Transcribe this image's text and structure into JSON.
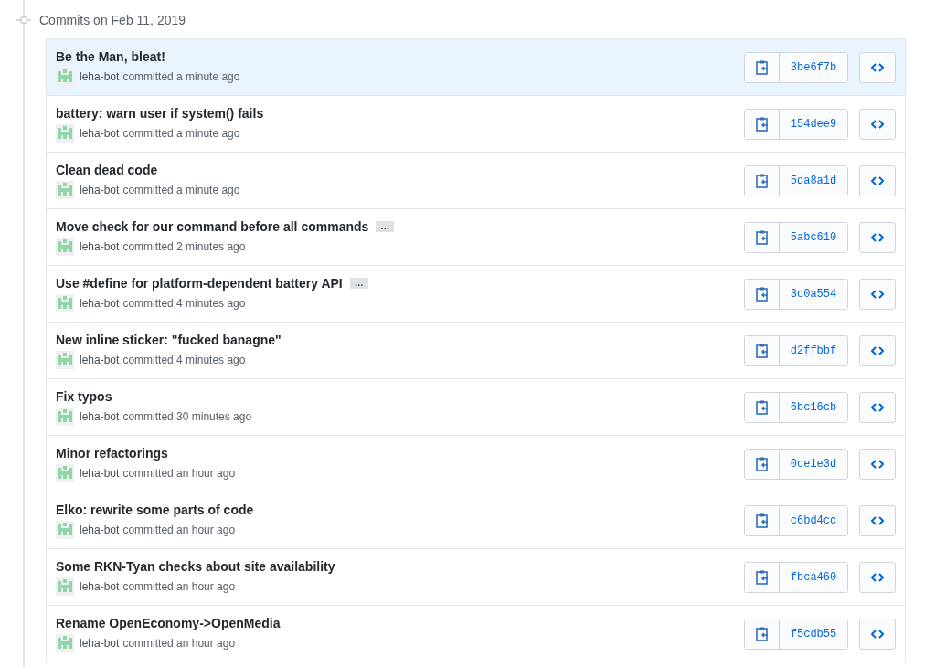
{
  "header": {
    "title": "Commits on Feb 11, 2019"
  },
  "commits": [
    {
      "message": "Be the Man, bleat!",
      "author": "leha-bot",
      "when": "committed a minute ago",
      "sha": "3be6f7b",
      "highlighted": true
    },
    {
      "message": "battery: warn user if system() fails",
      "author": "leha-bot",
      "when": "committed a minute ago",
      "sha": "154dee9",
      "highlighted": false
    },
    {
      "message": "Clean dead code",
      "author": "leha-bot",
      "when": "committed a minute ago",
      "sha": "5da8a1d",
      "highlighted": false
    },
    {
      "message": "Move check for our command before all commands",
      "expander": "…",
      "author": "leha-bot",
      "when": "committed 2 minutes ago",
      "sha": "5abc610",
      "highlighted": false
    },
    {
      "message": "Use #define for platform-dependent battery API",
      "expander": "…",
      "author": "leha-bot",
      "when": "committed 4 minutes ago",
      "sha": "3c0a554",
      "highlighted": false
    },
    {
      "message": "New inline sticker: \"fucked banagne\"",
      "author": "leha-bot",
      "when": "committed 4 minutes ago",
      "sha": "d2ffbbf",
      "highlighted": false
    },
    {
      "message": "Fix typos",
      "author": "leha-bot",
      "when": "committed 30 minutes ago",
      "sha": "6bc16cb",
      "highlighted": false
    },
    {
      "message": "Minor refactorings",
      "author": "leha-bot",
      "when": "committed an hour ago",
      "sha": "0ce1e3d",
      "highlighted": false
    },
    {
      "message": "Elko: rewrite some parts of code",
      "author": "leha-bot",
      "when": "committed an hour ago",
      "sha": "c6bd4cc",
      "highlighted": false
    },
    {
      "message": "Some RKN-Tyan checks about site availability",
      "author": "leha-bot",
      "when": "committed an hour ago",
      "sha": "fbca460",
      "highlighted": false
    },
    {
      "message": "Rename OpenEconomy->OpenMedia",
      "author": "leha-bot",
      "when": "committed an hour ago",
      "sha": "f5cdb55",
      "highlighted": false
    }
  ]
}
